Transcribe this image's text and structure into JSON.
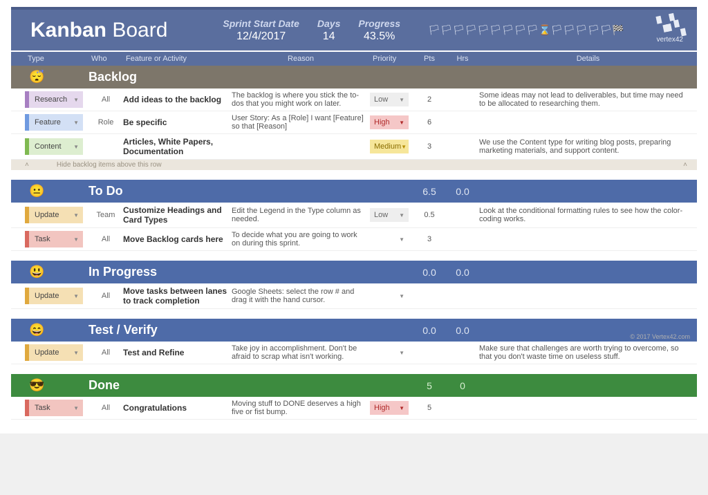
{
  "header": {
    "title_bold": "Kanban",
    "title_rest": "Board",
    "sprint_label": "Sprint Start Date",
    "sprint_value": "12/4/2017",
    "days_label": "Days",
    "days_value": "14",
    "progress_label": "Progress",
    "progress_value": "43.5%",
    "logo_text": "vertex42"
  },
  "columns": {
    "type": "Type",
    "who": "Who",
    "feature": "Feature or Activity",
    "reason": "Reason",
    "priority": "Priority",
    "pts": "Pts",
    "hrs": "Hrs",
    "details": "Details"
  },
  "lanes": {
    "backlog": {
      "name": "Backlog",
      "face": "😴",
      "hide_text": "Hide backlog items above this row",
      "rows": [
        {
          "type": "Research",
          "who": "All",
          "feature": "Add ideas to the backlog",
          "reason": "The backlog is where you stick the to-dos that you might work on later.",
          "priority": "Low",
          "pts": "2",
          "details": "Some ideas may not lead to deliverables, but time may need to be allocated to researching them."
        },
        {
          "type": "Feature",
          "who": "Role",
          "feature": "Be specific",
          "reason": "User Story: As a [Role] I want [Feature] so that [Reason]",
          "priority": "High",
          "pts": "6",
          "details": ""
        },
        {
          "type": "Content",
          "who": "",
          "feature": "Articles, White Papers, Documentation",
          "reason": "",
          "priority": "Medium",
          "pts": "3",
          "details": "We use the Content type for writing blog posts, preparing marketing materials, and support content."
        }
      ]
    },
    "todo": {
      "name": "To Do",
      "face": "😐",
      "pts_total": "6.5",
      "hrs_total": "0.0",
      "rows": [
        {
          "type": "Update",
          "who": "Team",
          "feature": "Customize Headings and Card Types",
          "reason": "Edit the Legend in the Type column as needed.",
          "priority": "Low",
          "pts": "0.5",
          "details": "Look at the conditional formatting rules to see how the color-coding works."
        },
        {
          "type": "Task",
          "who": "All",
          "feature": "Move Backlog cards here",
          "reason": "To decide what you are going to work on during this sprint.",
          "priority": "",
          "pts": "3",
          "details": ""
        }
      ]
    },
    "inprogress": {
      "name": "In Progress",
      "face": "😃",
      "pts_total": "0.0",
      "hrs_total": "0.0",
      "rows": [
        {
          "type": "Update",
          "who": "All",
          "feature": "Move tasks between lanes to track completion",
          "reason": "Google Sheets: select the row # and drag it with the hand cursor.",
          "priority": "",
          "pts": "",
          "details": ""
        }
      ]
    },
    "test": {
      "name": "Test / Verify",
      "face": "😄",
      "pts_total": "0.0",
      "hrs_total": "0.0",
      "copyright": "© 2017 Vertex42.com",
      "rows": [
        {
          "type": "Update",
          "who": "All",
          "feature": "Test and Refine",
          "reason": "Take joy in accomplishment. Don't be afraid to scrap what isn't working.",
          "priority": "",
          "pts": "",
          "details": "Make sure that challenges are worth trying to overcome, so that you don't waste time on useless stuff."
        }
      ]
    },
    "done": {
      "name": "Done",
      "face": "😎",
      "pts_total": "5",
      "hrs_total": "0",
      "rows": [
        {
          "type": "Task",
          "who": "All",
          "feature": "Congratulations",
          "reason": "Moving stuff to DONE deserves a high five or fist bump.",
          "priority": "High",
          "pts": "5",
          "details": ""
        }
      ]
    }
  }
}
